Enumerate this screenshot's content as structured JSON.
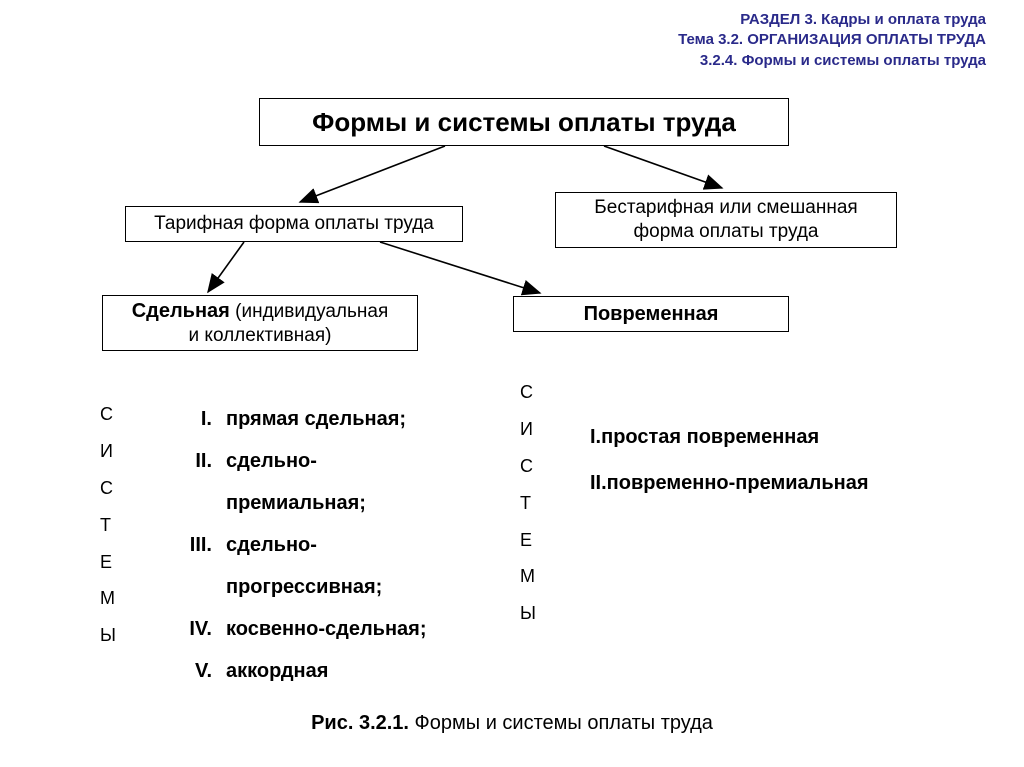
{
  "header": {
    "line1": "РАЗДЕЛ 3. Кадры и оплата труда",
    "line2": "Тема 3.2. ОРГАНИЗАЦИЯ ОПЛАТЫ ТРУДА",
    "line3": "3.2.4. Формы и системы оплаты труда"
  },
  "boxes": {
    "title": "Формы и системы оплаты труда",
    "tariff": "Тарифная форма оплаты труда",
    "nontariff_l1": "Бестарифная или смешанная",
    "nontariff_l2": "форма оплаты труда",
    "piecework_bold": "Сдельная",
    "piecework_rest": " (индивидуальная",
    "piecework_l2": "и коллективная)",
    "timebased": "Повременная"
  },
  "vertical_label": {
    "c0": "С",
    "c1": "И",
    "c2": "С",
    "c3": "Т",
    "c4": "Е",
    "c5": "М",
    "c6": "Ы"
  },
  "piecework_list": {
    "n1": "I.",
    "t1": "прямая сдельная;",
    "n2": "II.",
    "t2a": "сдельно-",
    "t2b": "премиальная;",
    "n3": "III.",
    "t3a": "сдельно-",
    "t3b": "прогрессивная;",
    "n4": "IV.",
    "t4": "косвенно-сдельная;",
    "n5": "V.",
    "t5": "аккордная"
  },
  "timebased_list": {
    "t1": "I.простая повременная",
    "t2": "II.повременно-премиальная"
  },
  "caption": {
    "bold": "Рис. 3.2.1.",
    "rest": "  Формы и системы оплаты труда"
  }
}
